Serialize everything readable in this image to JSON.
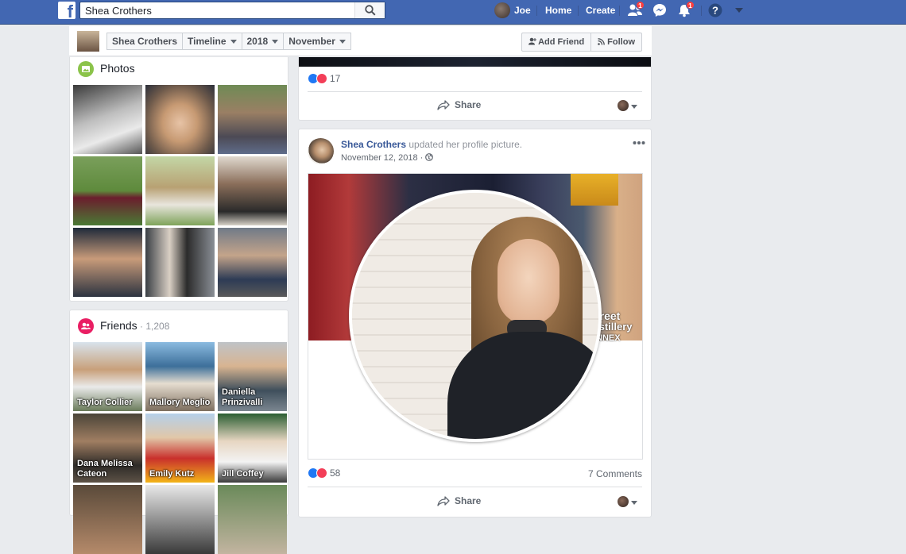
{
  "topbar": {
    "logo": "f",
    "search_value": "Shea Crothers",
    "user_name": "Joe",
    "home": "Home",
    "create": "Create",
    "friend_requests_badge": "1",
    "notifications_badge": "1"
  },
  "subnav": {
    "profile_name": "Shea Crothers",
    "timeline": "Timeline",
    "year": "2018",
    "month": "November",
    "add_friend": "Add Friend",
    "follow": "Follow"
  },
  "photos": {
    "title": "Photos"
  },
  "friends": {
    "title": "Friends",
    "count": " · 1,208",
    "items": [
      {
        "name": "Taylor Collier"
      },
      {
        "name": "Mallory Meglio"
      },
      {
        "name": "Daniella\nPrinzivalli"
      },
      {
        "name": "Dana Melissa\nCateon"
      },
      {
        "name": "Emily Kutz"
      },
      {
        "name": "Jill Coffey"
      }
    ]
  },
  "post1": {
    "reaction_count": "17",
    "share": "Share"
  },
  "post2": {
    "author": "Shea Crothers",
    "action": " updated her profile picture.",
    "date": "November 12, 2018 · ",
    "reaction_count": "58",
    "comments": "7 Comments",
    "share": "Share",
    "sign_text_1": "treet",
    "sign_text_2": "istillery",
    "sign_text_3": "NNEX"
  },
  "colors": {
    "brand": "#4267b2",
    "link": "#385898",
    "badge": "#fa3e3e"
  }
}
